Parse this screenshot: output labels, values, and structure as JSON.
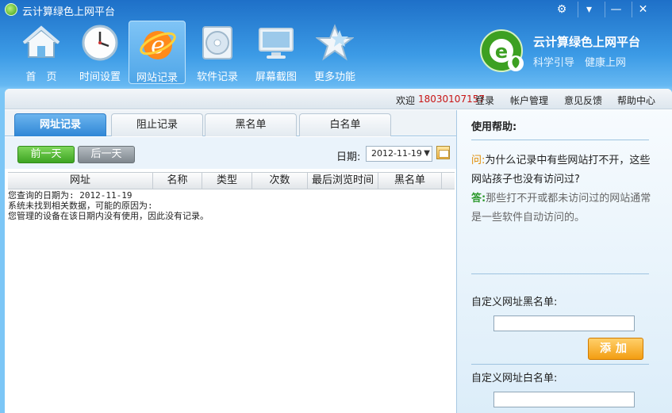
{
  "window": {
    "title": "云计算绿色上网平台",
    "controls": [
      "⚙",
      "▾",
      "—",
      "✕"
    ]
  },
  "nav": [
    {
      "label": "首　页",
      "icon": "home-icon"
    },
    {
      "label": "时间设置",
      "icon": "clock-icon"
    },
    {
      "label": "网站记录",
      "icon": "browser-e-icon",
      "active": true
    },
    {
      "label": "软件记录",
      "icon": "disc-icon"
    },
    {
      "label": "屏幕截图",
      "icon": "monitor-icon"
    },
    {
      "label": "更多功能",
      "icon": "star-icon"
    }
  ],
  "brand": {
    "name": "云计算绿色上网平台",
    "slogan": "科学引导　健康上网"
  },
  "topbar": {
    "welcome": "欢迎",
    "phone": "18030107157",
    "login": "登录",
    "account": "帐户管理",
    "feedback": "意见反馈",
    "help": "帮助中心"
  },
  "tabs": [
    "网址记录",
    "阻止记录",
    "黑名单",
    "白名单"
  ],
  "toolbar": {
    "prev_day": "前一天",
    "next_day": "后一天",
    "date_label": "日期:",
    "date_value": "2012-11-19"
  },
  "table": {
    "columns": [
      "网址",
      "名称",
      "类型",
      "次数",
      "最后浏览时间",
      "黑名单"
    ],
    "messages": [
      "您查询的日期为:  2012-11-19",
      "系统未找到相关数据，可能的原因为:",
      "您管理的设备在该日期内没有使用，因此没有记录。"
    ]
  },
  "help": {
    "title": "使用帮助:",
    "q_mark": "问:",
    "question": "为什么记录中有些网站打不开，这些网站孩子也没有访问过?",
    "a_mark": "答:",
    "answer": "那些打不开或都未访问过的网站通常是一些软件自动访问的。",
    "blacklist_label": "自定义网址黑名单:",
    "blacklist_value": "",
    "add_label": "添加",
    "whitelist_label": "自定义网址白名单:",
    "whitelist_value": ""
  },
  "colors": {
    "accent": "#2f86d6",
    "phone": "#c81414",
    "prev_btn": "#3ea423",
    "add_btn": "#f39d12"
  }
}
